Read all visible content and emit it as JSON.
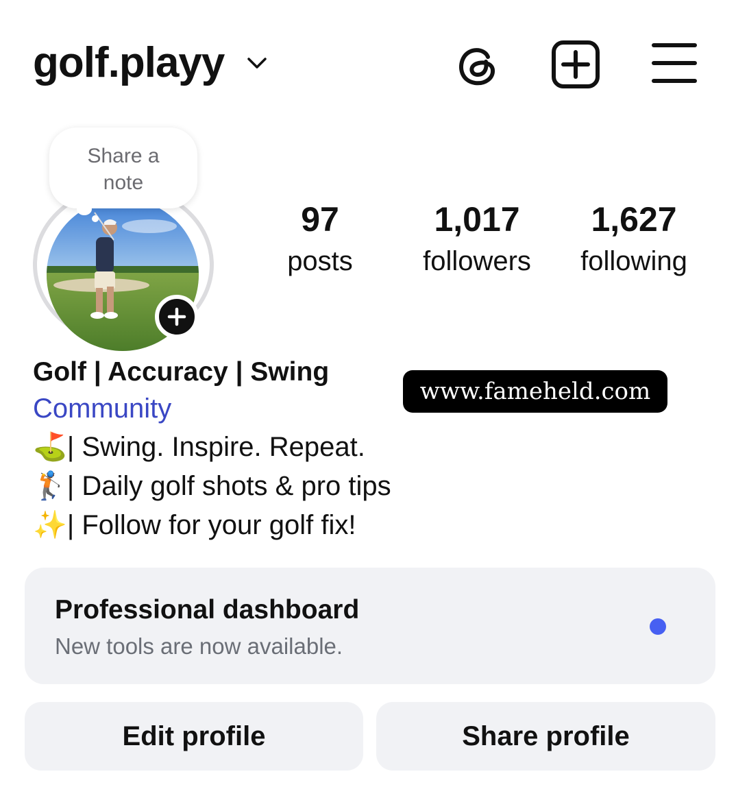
{
  "header": {
    "username": "golf.playy",
    "icons": [
      "chevron-down-icon",
      "threads-icon",
      "new-post-icon",
      "menu-icon"
    ]
  },
  "note": {
    "text": "Share a note"
  },
  "stats": {
    "posts": {
      "value": "97",
      "label": "posts"
    },
    "followers": {
      "value": "1,017",
      "label": "followers"
    },
    "following": {
      "value": "1,627",
      "label": "following"
    }
  },
  "bio": {
    "name": "Golf | Accuracy | Swing",
    "category": "Community",
    "lines": [
      {
        "emoji": "⛳",
        "text": "| Swing. Inspire. Repeat."
      },
      {
        "emoji": "🏌",
        "text": "| Daily golf shots & pro tips"
      },
      {
        "emoji": "✨",
        "text": "| Follow for your golf fix!"
      }
    ]
  },
  "watermark": "www.fameheld.com",
  "dashboard": {
    "title": "Professional dashboard",
    "subtitle": "New tools are now available."
  },
  "buttons": {
    "edit": "Edit profile",
    "share": "Share profile"
  },
  "colors": {
    "link": "#3a47c4",
    "notification_dot": "#4760f2",
    "button_bg": "#f1f2f5"
  }
}
